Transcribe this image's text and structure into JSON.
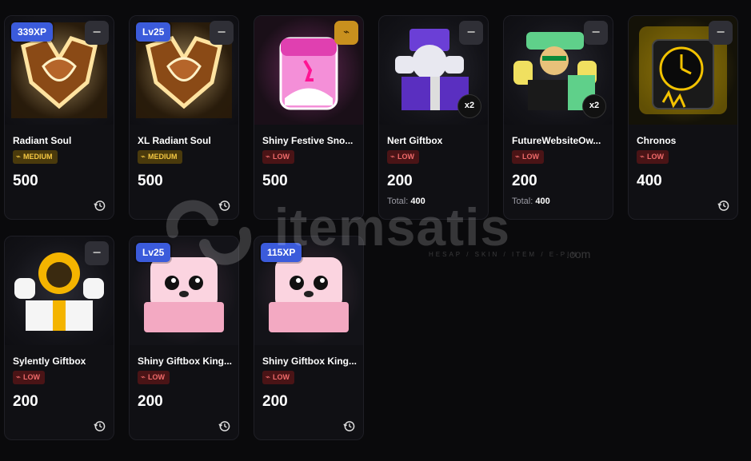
{
  "cards": [
    {
      "name": "Radiant Soul",
      "demand": "MEDIUM",
      "value": "500",
      "badge": "339XP",
      "qty": "",
      "total": "",
      "button": "−"
    },
    {
      "name": "XL Radiant Soul",
      "demand": "MEDIUM",
      "value": "500",
      "badge": "Lv25",
      "qty": "",
      "total": "",
      "button": "−"
    },
    {
      "name": "Shiny Festive Sno...",
      "demand": "LOW",
      "value": "500",
      "badge": "",
      "qty": "",
      "total": "",
      "button": "⌁"
    },
    {
      "name": "Nert Giftbox",
      "demand": "LOW",
      "value": "200",
      "badge": "",
      "qty": "x2",
      "total_label": "Total:",
      "total": "400",
      "button": "−"
    },
    {
      "name": "FutureWebsiteOw...",
      "demand": "LOW",
      "value": "200",
      "badge": "",
      "qty": "x2",
      "total_label": "Total:",
      "total": "400",
      "button": "−"
    },
    {
      "name": "Chronos",
      "demand": "LOW",
      "value": "400",
      "badge": "",
      "qty": "",
      "total": "",
      "button": "−"
    },
    {
      "name": "Sylently Giftbox",
      "demand": "LOW",
      "value": "200",
      "badge": "",
      "qty": "",
      "total": "",
      "button": "−"
    },
    {
      "name": "Shiny Giftbox King...",
      "demand": "LOW",
      "value": "200",
      "badge": "Lv25",
      "qty": "",
      "total": "",
      "button": ""
    },
    {
      "name": "Shiny Giftbox King...",
      "demand": "LOW",
      "value": "200",
      "badge": "115XP",
      "qty": "",
      "total": "",
      "button": ""
    }
  ],
  "watermark": {
    "text": "itemsatis",
    "sub": "HESAP / SKIN / ITEM / E-PIN",
    "domain": ".com"
  },
  "colors": {
    "medium": "#f5c842",
    "low": "#f06a6a",
    "badge": "#3b5bdb",
    "background": "#0a0a0c"
  },
  "icons": {
    "history": "history-icon",
    "remove": "minus-icon",
    "demand": "pulse-icon"
  }
}
